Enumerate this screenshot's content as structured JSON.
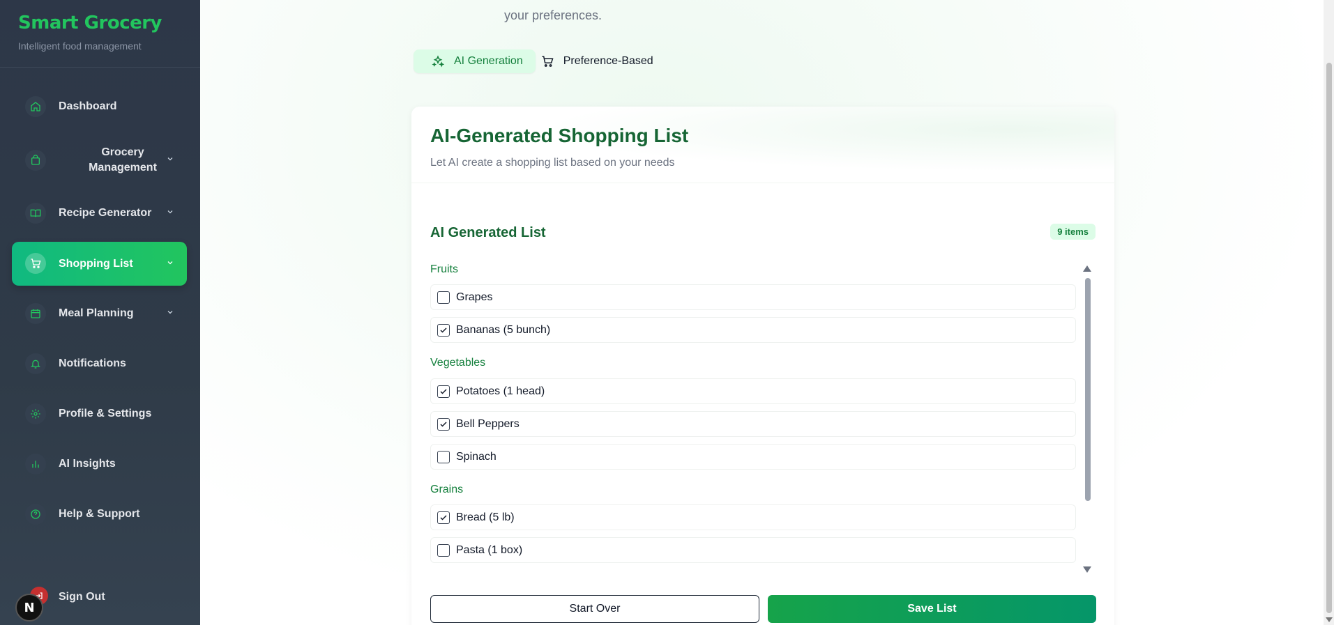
{
  "brand": {
    "title": "Smart Grocery",
    "subtitle": "Intelligent food management"
  },
  "nav": [
    {
      "label": "Dashboard",
      "icon": "home-icon",
      "chevron": false
    },
    {
      "label": "Grocery Management",
      "icon": "bag-icon",
      "chevron": true
    },
    {
      "label": "Recipe Generator",
      "icon": "book-icon",
      "chevron": true
    },
    {
      "label": "Shopping List",
      "icon": "cart-icon",
      "chevron": true,
      "active": true
    },
    {
      "label": "Meal Planning",
      "icon": "calendar-icon",
      "chevron": true
    },
    {
      "label": "Notifications",
      "icon": "bell-icon",
      "chevron": false
    },
    {
      "label": "Profile & Settings",
      "icon": "gear-icon",
      "chevron": false
    },
    {
      "label": "AI Insights",
      "icon": "bar-chart-icon",
      "chevron": false
    },
    {
      "label": "Help & Support",
      "icon": "help-circle-icon",
      "chevron": false
    }
  ],
  "signout": {
    "label": "Sign Out"
  },
  "dev_badge": "N",
  "intro": {
    "line2": "your preferences."
  },
  "tabs": {
    "ai": "AI Generation",
    "pref": "Preference-Based"
  },
  "card": {
    "title": "AI-Generated Shopping List",
    "subtitle": "Let AI create a shopping list based on your needs",
    "list_title": "AI Generated List",
    "count": "9 items"
  },
  "categories": {
    "fruits": "Fruits",
    "vegetables": "Vegetables",
    "grains": "Grains"
  },
  "items": [
    {
      "label": "Grapes",
      "checked": false
    },
    {
      "label": "Bananas (5 bunch)",
      "checked": true
    },
    {
      "label": "Potatoes (1 head)",
      "checked": true
    },
    {
      "label": "Bell Peppers",
      "checked": true
    },
    {
      "label": "Spinach",
      "checked": false
    },
    {
      "label": "Bread (5 lb)",
      "checked": true
    },
    {
      "label": "Pasta (1 box)",
      "checked": false
    }
  ],
  "buttons": {
    "start_over": "Start Over",
    "save_list": "Save List"
  },
  "colors": {
    "accent": "#22c55e",
    "brand_dark": "#166534",
    "sidebar": "#2d3748"
  }
}
